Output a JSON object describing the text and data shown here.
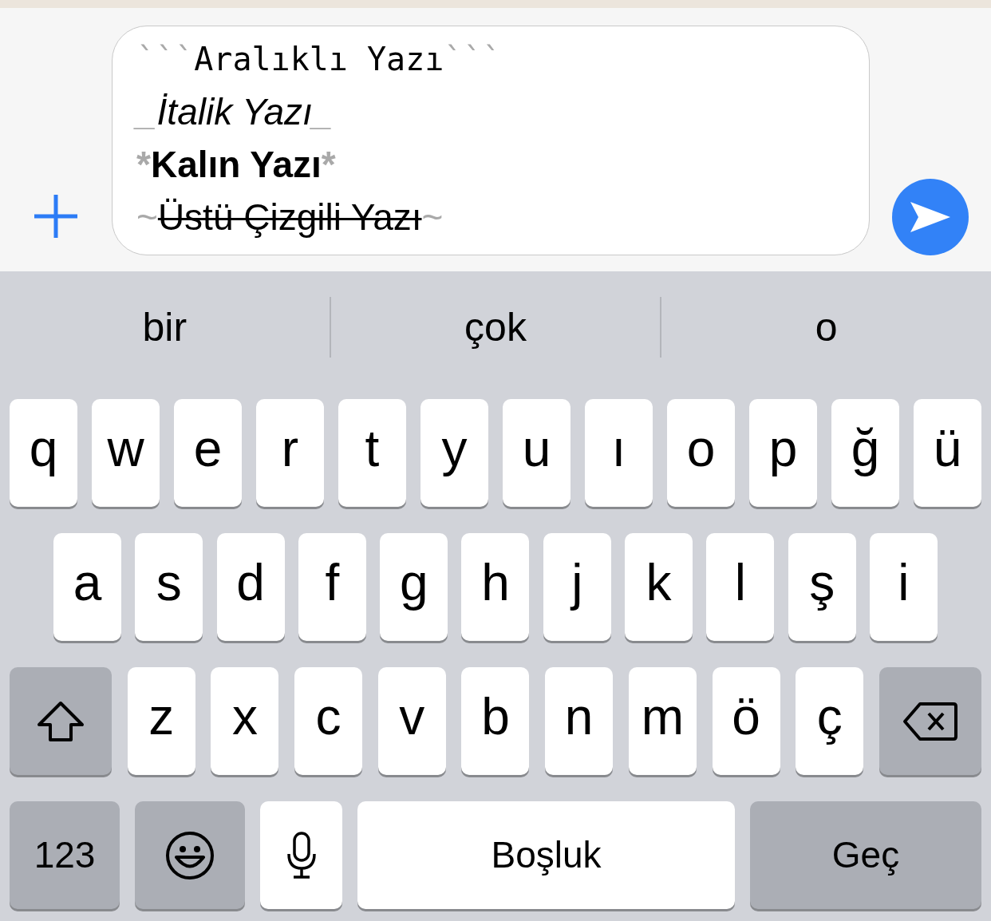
{
  "composer": {
    "lines": [
      {
        "kind": "mono",
        "marker": "```",
        "text": "Aralıklı Yazı"
      },
      {
        "kind": "italic",
        "marker": "_",
        "text": "İtalik Yazı"
      },
      {
        "kind": "bold",
        "marker": "*",
        "text": "Kalın Yazı"
      },
      {
        "kind": "strike",
        "marker": "~",
        "text": "Üstü Çizgili Yazı"
      }
    ]
  },
  "suggestions": [
    "bir",
    "çok",
    "o"
  ],
  "keyboard": {
    "rows": [
      [
        {
          "kind": "letter",
          "label": "q"
        },
        {
          "kind": "letter",
          "label": "w"
        },
        {
          "kind": "letter",
          "label": "e"
        },
        {
          "kind": "letter",
          "label": "r"
        },
        {
          "kind": "letter",
          "label": "t"
        },
        {
          "kind": "letter",
          "label": "y"
        },
        {
          "kind": "letter",
          "label": "u"
        },
        {
          "kind": "letter",
          "label": "ı"
        },
        {
          "kind": "letter",
          "label": "o"
        },
        {
          "kind": "letter",
          "label": "p"
        },
        {
          "kind": "letter",
          "label": "ğ"
        },
        {
          "kind": "letter",
          "label": "ü"
        }
      ],
      [
        {
          "kind": "letter",
          "label": "a"
        },
        {
          "kind": "letter",
          "label": "s"
        },
        {
          "kind": "letter",
          "label": "d"
        },
        {
          "kind": "letter",
          "label": "f"
        },
        {
          "kind": "letter",
          "label": "g"
        },
        {
          "kind": "letter",
          "label": "h"
        },
        {
          "kind": "letter",
          "label": "j"
        },
        {
          "kind": "letter",
          "label": "k"
        },
        {
          "kind": "letter",
          "label": "l"
        },
        {
          "kind": "letter",
          "label": "ş"
        },
        {
          "kind": "letter",
          "label": "i"
        }
      ],
      [
        {
          "kind": "shift"
        },
        {
          "kind": "letter",
          "label": "z"
        },
        {
          "kind": "letter",
          "label": "x"
        },
        {
          "kind": "letter",
          "label": "c"
        },
        {
          "kind": "letter",
          "label": "v"
        },
        {
          "kind": "letter",
          "label": "b"
        },
        {
          "kind": "letter",
          "label": "n"
        },
        {
          "kind": "letter",
          "label": "m"
        },
        {
          "kind": "letter",
          "label": "ö"
        },
        {
          "kind": "letter",
          "label": "ç"
        },
        {
          "kind": "delete"
        }
      ]
    ],
    "bottom_row": [
      {
        "kind": "numbers",
        "label": "123"
      },
      {
        "kind": "emoji"
      },
      {
        "kind": "mic"
      },
      {
        "kind": "space",
        "label": "Boşluk"
      },
      {
        "kind": "return",
        "label": "Geç"
      }
    ]
  }
}
